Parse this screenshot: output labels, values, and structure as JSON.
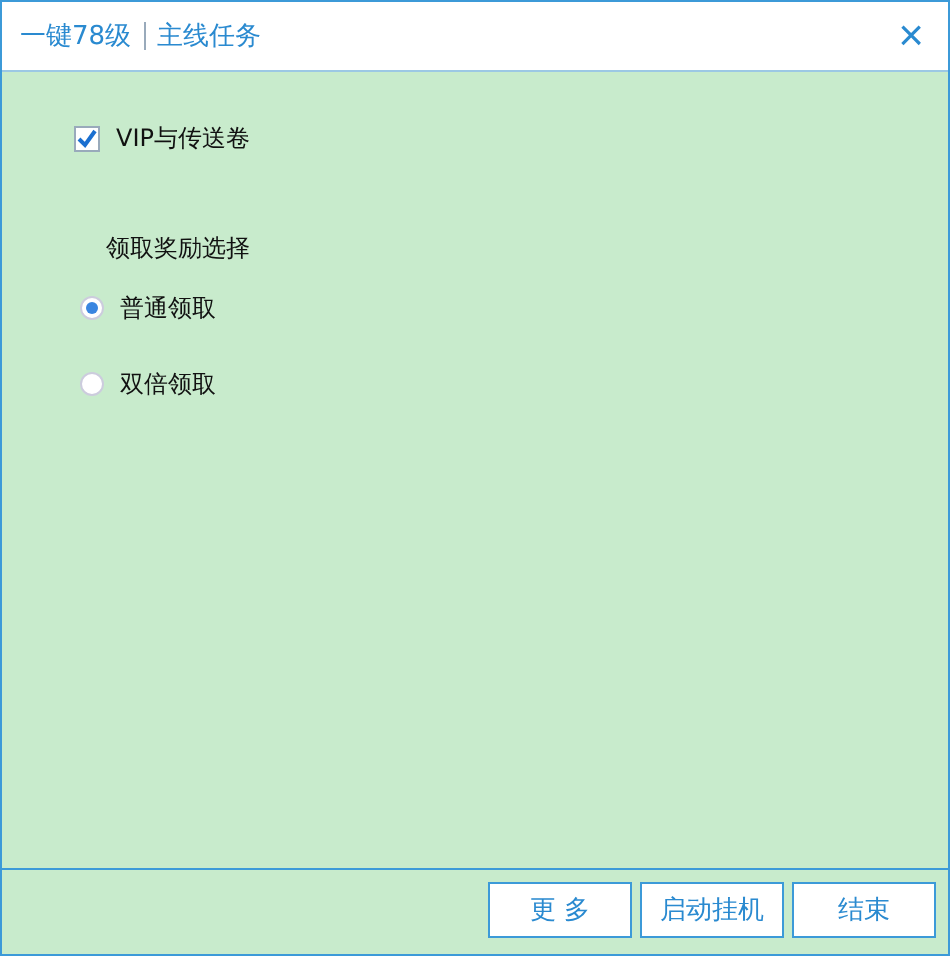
{
  "window": {
    "title": "一键78级",
    "subtitle": "主线任务",
    "close": "×"
  },
  "options": [
    {
      "label": "VIP与传送卷",
      "checked": true
    }
  ],
  "reward": {
    "heading": "领取奖励选择",
    "choices": [
      {
        "label": "普通领取",
        "selected": true
      },
      {
        "label": "双倍领取",
        "selected": false
      }
    ]
  },
  "buttons": [
    "更 多",
    "启动挂机",
    "结束"
  ]
}
